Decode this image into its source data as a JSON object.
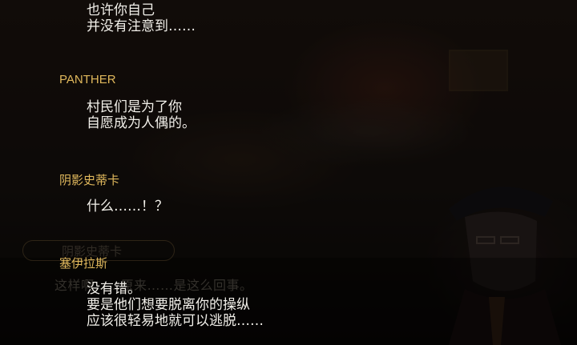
{
  "background_dialog": {
    "name": "阴影史蒂卡",
    "line": "这样啊……原来……是这么回事。"
  },
  "backlog": [
    {
      "speaker": "",
      "lines": [
        "也许你自己",
        "并没有注意到……"
      ]
    },
    {
      "speaker": "PANTHER",
      "lines": [
        "村民们是为了你",
        "自愿成为人偶的。"
      ]
    },
    {
      "speaker": "阴影史蒂卡",
      "lines": [
        "什么……！？"
      ]
    },
    {
      "speaker": "塞伊拉斯",
      "lines": [
        "没有错。",
        "要是他们想要脱离你的操纵",
        "应该很轻易地就可以逃脱……"
      ]
    }
  ],
  "colors": {
    "speaker": "#e0b85c",
    "text": "#f2f0ea"
  }
}
